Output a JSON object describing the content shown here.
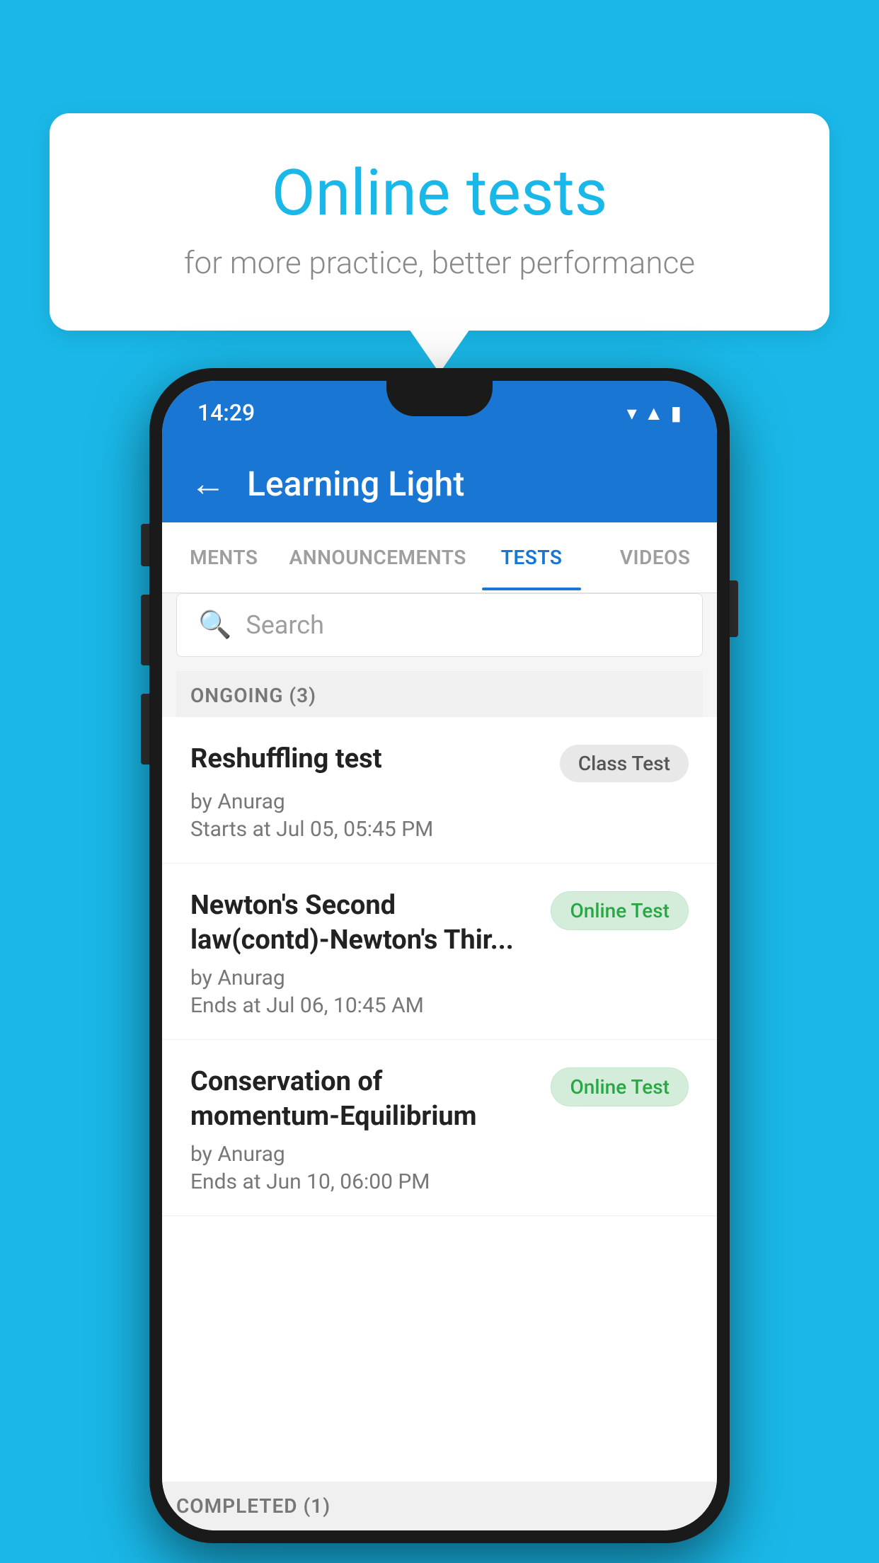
{
  "background_color": "#1ab8e8",
  "bubble": {
    "title": "Online tests",
    "subtitle": "for more practice, better performance"
  },
  "phone": {
    "status_bar": {
      "time": "14:29",
      "icons": [
        "wifi",
        "signal",
        "battery"
      ]
    },
    "app_bar": {
      "back_icon": "←",
      "title": "Learning Light"
    },
    "tabs": [
      {
        "label": "MENTS",
        "active": false
      },
      {
        "label": "ANNOUNCEMENTS",
        "active": false
      },
      {
        "label": "TESTS",
        "active": true
      },
      {
        "label": "VIDEOS",
        "active": false
      }
    ],
    "search": {
      "placeholder": "Search",
      "icon": "🔍"
    },
    "ongoing_section": {
      "label": "ONGOING (3)"
    },
    "tests": [
      {
        "title": "Reshuffling test",
        "badge": "Class Test",
        "badge_type": "class",
        "by": "by Anurag",
        "date_label": "Starts at",
        "date": "Jul 05, 05:45 PM"
      },
      {
        "title": "Newton's Second law(contd)-Newton's Thir...",
        "badge": "Online Test",
        "badge_type": "online",
        "by": "by Anurag",
        "date_label": "Ends at",
        "date": "Jul 06, 10:45 AM"
      },
      {
        "title": "Conservation of momentum-Equilibrium",
        "badge": "Online Test",
        "badge_type": "online",
        "by": "by Anurag",
        "date_label": "Ends at",
        "date": "Jun 10, 06:00 PM"
      }
    ],
    "completed_section": {
      "label": "COMPLETED (1)"
    }
  }
}
